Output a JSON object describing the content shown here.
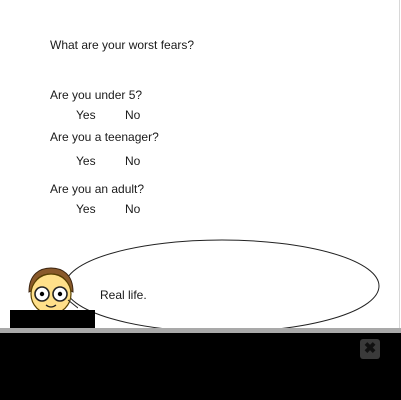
{
  "prompt": "What are your worst fears?",
  "questions": [
    {
      "text": "Are you under 5?",
      "yes": "Yes",
      "no": "No"
    },
    {
      "text": "Are you a teenager?",
      "yes": "Yes",
      "no": "No"
    },
    {
      "text": "Are you an adult?",
      "yes": "Yes",
      "no": "No"
    }
  ],
  "speech": "Real life.",
  "close_icon": "close-icon",
  "colors": {
    "panel": "#000000",
    "separator": "#a9a9a9",
    "face": "#ffe08a",
    "hair": "#8a5a2b"
  }
}
